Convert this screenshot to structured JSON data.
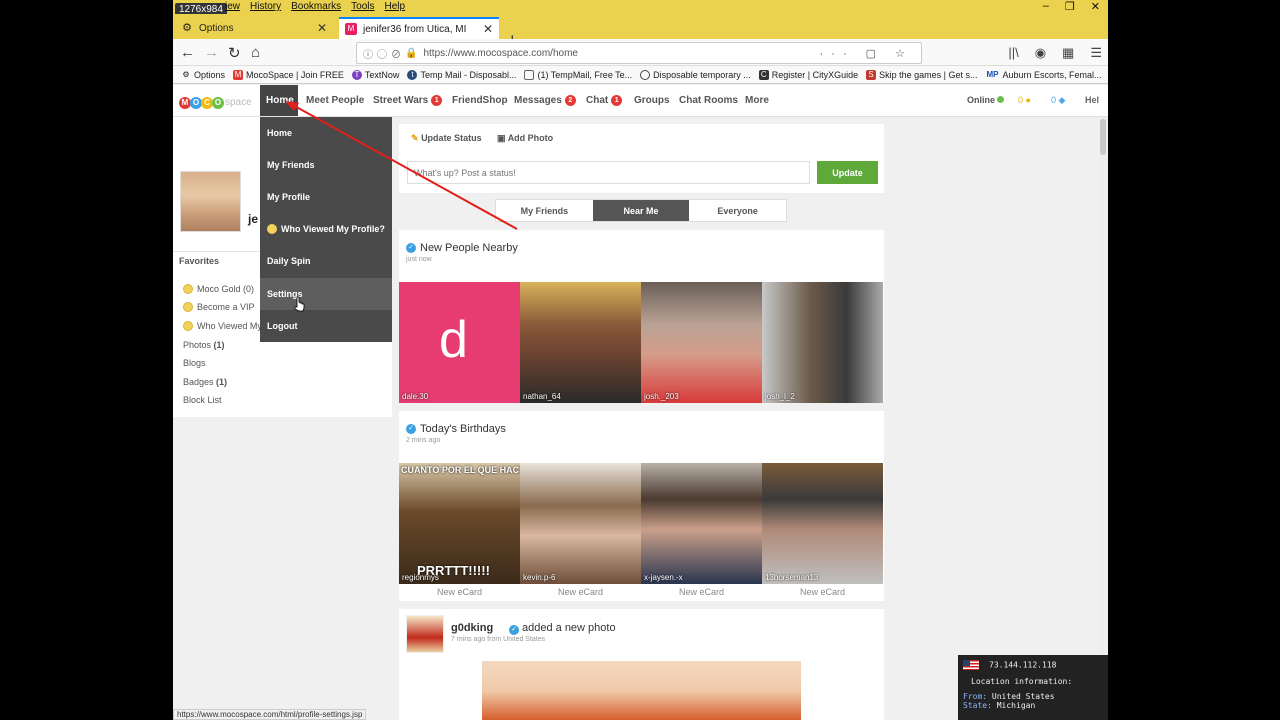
{
  "browser": {
    "resolution_badge": "1276x984",
    "menu": [
      "iew",
      "History",
      "Bookmarks",
      "Tools",
      "Help"
    ],
    "tabs": [
      {
        "label": "Options",
        "icon": "gear-icon"
      },
      {
        "label": "jenifer36 from Utica, MI",
        "icon": "mocospace-icon"
      }
    ],
    "url": "https://www.mocospace.com/home",
    "bookmarks": [
      {
        "label": "Options",
        "icon": "gear-icon"
      },
      {
        "label": "MocoSpace | Join FREE",
        "icon": "mocospace-icon"
      },
      {
        "label": "TextNow",
        "icon": "textnow-icon"
      },
      {
        "label": "Temp Mail - Disposabl...",
        "icon": "tempmail-icon"
      },
      {
        "label": "(1) TempMail, Free Te...",
        "icon": "mail-icon"
      },
      {
        "label": "Disposable temporary ...",
        "icon": "globe-icon"
      },
      {
        "label": "Register | CityXGuide",
        "icon": "cityx-icon"
      },
      {
        "label": "Skip the games | Get s...",
        "icon": "skip-icon"
      },
      {
        "label": "Auburn Escorts, Femal...",
        "icon": "mp-icon"
      }
    ],
    "status_url": "https://www.mocospace.com/html/profile-settings.jsp"
  },
  "site": {
    "logo_text": "space",
    "nav": [
      {
        "label": "Home",
        "badge": ""
      },
      {
        "label": "Meet People",
        "badge": ""
      },
      {
        "label": "Street Wars",
        "badge": "1"
      },
      {
        "label": "FriendShop",
        "badge": ""
      },
      {
        "label": "Messages",
        "badge": "2"
      },
      {
        "label": "Chat",
        "badge": "1"
      },
      {
        "label": "Groups",
        "badge": ""
      },
      {
        "label": "Chat Rooms",
        "badge": ""
      },
      {
        "label": "More",
        "badge": ""
      }
    ],
    "online_label": "Online",
    "gold_count": "0",
    "gem_count": "0",
    "help_label": "Hel"
  },
  "dropdown": {
    "items": [
      "Home",
      "My Friends",
      "My Profile",
      "Who Viewed My Profile?",
      "Daily Spin",
      "Settings",
      "Logout"
    ]
  },
  "left": {
    "username_partial": "je",
    "favorites_label": "Favorites",
    "items": [
      {
        "label": "Moco Gold (0)",
        "coin": true
      },
      {
        "label": "Become a VIP",
        "coin": true
      },
      {
        "label": "Who Viewed My",
        "coin": true
      },
      {
        "label": "Photos",
        "count": "(1)"
      },
      {
        "label": "Blogs",
        "count": ""
      },
      {
        "label": "Badges",
        "count": "(1)"
      },
      {
        "label": "Block List",
        "count": ""
      }
    ]
  },
  "status": {
    "update_status": "Update Status",
    "add_photo": "Add Photo",
    "placeholder": "What's up? Post a status!",
    "update_button": "Update"
  },
  "seg_tabs": [
    "My Friends",
    "Near Me",
    "Everyone"
  ],
  "nearby": {
    "title": "New People Nearby",
    "time": "just now",
    "people": [
      "dale.30",
      "nathan_64",
      "josh._203",
      "josh_l_2"
    ]
  },
  "birthdays": {
    "title": "Today's Birthdays",
    "time": "2 mins ago",
    "people": [
      "regionmys",
      "kevin.p-6",
      "x-jaysen.-x",
      "13horseman13"
    ],
    "ecard_label": "New eCard",
    "meme_top": "CUANTO POR EL QUE HACE",
    "meme_bottom": "PRRTTT!!!!!"
  },
  "activity": {
    "user": "g0dking",
    "action": "added a new photo",
    "meta": "7 mins ago from United States"
  },
  "location": {
    "ip": "73.144.112.118",
    "heading": "Location information:",
    "from_label": "From:",
    "from_value": "United States",
    "state_label": "State:",
    "state_value": "Michigan"
  }
}
